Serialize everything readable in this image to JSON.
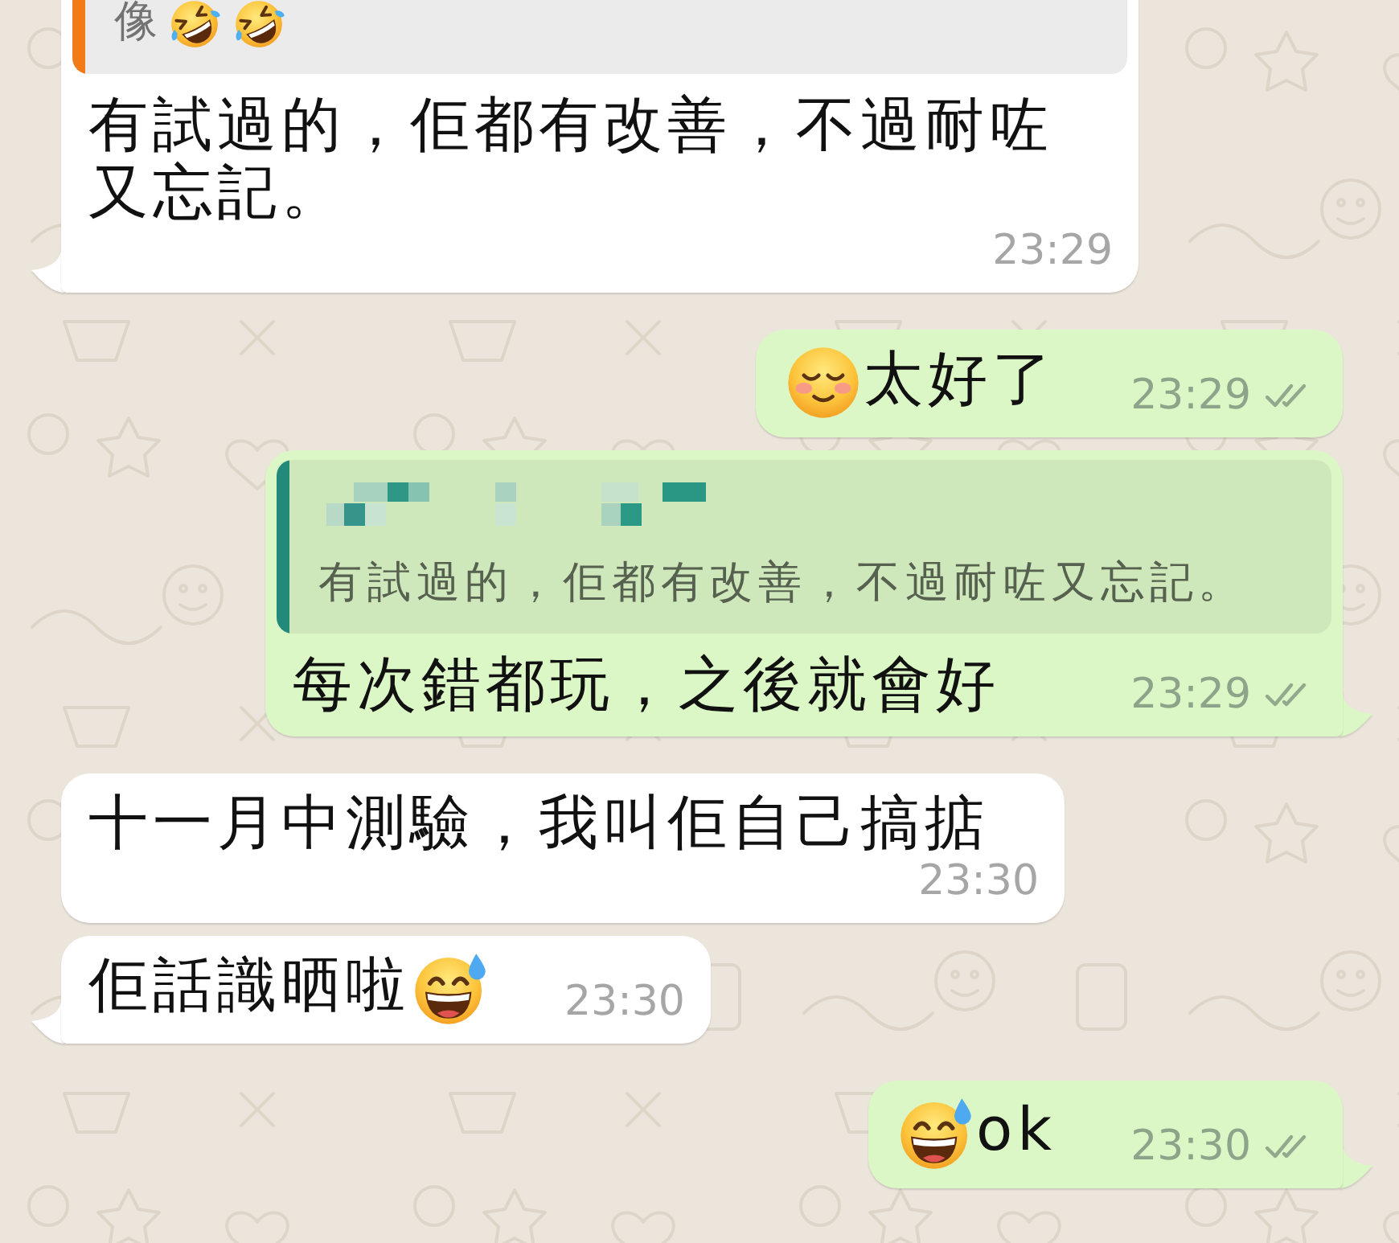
{
  "messages": [
    {
      "outgoing": false,
      "tail": true,
      "quote": {
        "color": "#f27b17",
        "parts": [
          {
            "kind": "text",
            "text": "像"
          },
          {
            "kind": "rofl"
          },
          {
            "kind": "rofl"
          }
        ]
      },
      "parts": [
        {
          "kind": "text",
          "text": "有試過的，佢都有改善，不過耐咗又忘記。"
        }
      ],
      "time": "23:29"
    },
    {
      "outgoing": true,
      "tail": false,
      "parts": [
        {
          "kind": "blush"
        },
        {
          "kind": "text",
          "text": "太好了"
        }
      ],
      "time": "23:29",
      "read": false
    },
    {
      "outgoing": true,
      "tail": true,
      "quote": {
        "color": "#22897b",
        "author": {
          "pixelated": true
        },
        "parts": [
          {
            "kind": "text",
            "text": "有試過的，佢都有改善，不過耐咗又忘記。"
          }
        ]
      },
      "parts": [
        {
          "kind": "text",
          "text": "每次錯都玩，之後就會好"
        }
      ],
      "time": "23:29",
      "read": false
    },
    {
      "outgoing": false,
      "tail": false,
      "parts": [
        {
          "kind": "text",
          "text": "十一月中測驗，我叫佢自己搞掂"
        }
      ],
      "time": "23:30"
    },
    {
      "outgoing": false,
      "tail": true,
      "parts": [
        {
          "kind": "text",
          "text": "佢話識晒啦"
        },
        {
          "kind": "sweat"
        }
      ],
      "time": "23:30"
    },
    {
      "outgoing": true,
      "tail": true,
      "parts": [
        {
          "kind": "sweat"
        },
        {
          "kind": "text",
          "text": "ok"
        }
      ],
      "time": "23:30",
      "read": false
    }
  ]
}
